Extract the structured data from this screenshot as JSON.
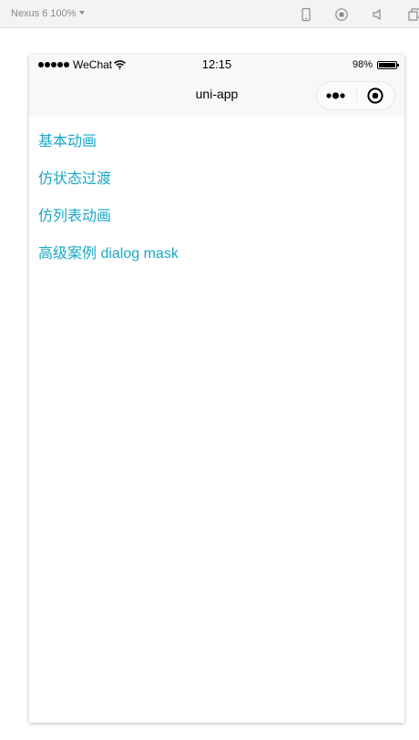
{
  "devtools": {
    "device_label": "Nexus 6 100%",
    "icons": [
      "phone-icon",
      "record-icon",
      "volume-icon",
      "window-icon"
    ]
  },
  "statusbar": {
    "carrier": "WeChat",
    "time": "12:15",
    "battery_text": "98%",
    "battery_level": 0.98
  },
  "navbar": {
    "title": "uni-app"
  },
  "menu": {
    "items": [
      {
        "label": "基本动画"
      },
      {
        "label": "仿状态过渡"
      },
      {
        "label": "仿列表动画"
      },
      {
        "label": "高级案例 dialog mask"
      }
    ]
  },
  "colors": {
    "link": "#1aa7c7",
    "bar": "#f8f8f8"
  }
}
